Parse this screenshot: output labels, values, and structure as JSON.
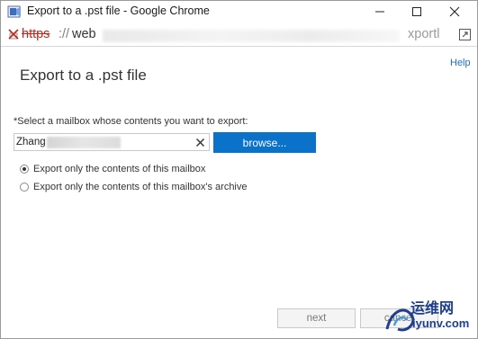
{
  "window": {
    "title": "Export to a .pst file - Google Chrome",
    "controls": {
      "minimize_icon": "minimize-icon",
      "maximize_icon": "maximize-icon",
      "close_icon": "close-icon"
    }
  },
  "addressbar": {
    "scheme": "https",
    "separator": "://",
    "host_visible": "web",
    "tail_visible": "xportl",
    "status_icon": "not-secure-icon"
  },
  "content": {
    "help_label": "Help",
    "title": "Export to a .pst file",
    "prompt": "*Select a mailbox whose contents you want to export:",
    "mailbox_value": "Zhang",
    "browse_label": "browse...",
    "options": [
      {
        "label": "Export only the contents of this mailbox",
        "checked": true
      },
      {
        "label": "Export only the contents of this mailbox's archive",
        "checked": false
      }
    ]
  },
  "footer": {
    "next_label": "next",
    "cancel_label": "cancel"
  },
  "watermark": {
    "cn_text": "运维网",
    "en_text": "iyunv.com"
  },
  "colors": {
    "accent": "#0a72c9",
    "link": "#1f6fc5",
    "insecure": "#c5251b",
    "watermark": "#1d3f8e"
  }
}
